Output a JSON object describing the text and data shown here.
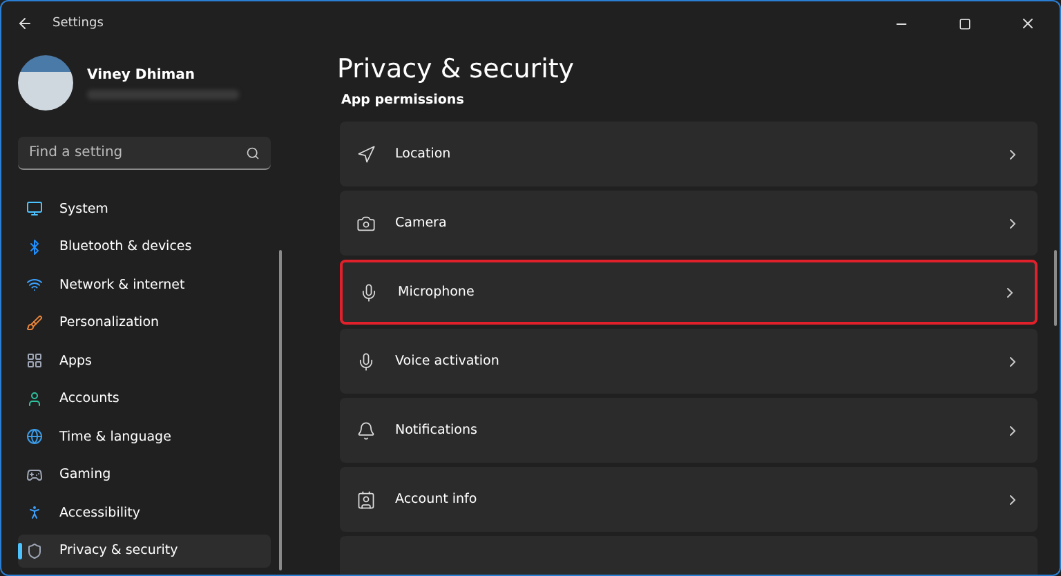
{
  "window": {
    "title": "Settings"
  },
  "user": {
    "name": "Viney Dhiman"
  },
  "search": {
    "placeholder": "Find a setting"
  },
  "sidebar": {
    "items": [
      {
        "label": "System",
        "selected": false
      },
      {
        "label": "Bluetooth & devices",
        "selected": false
      },
      {
        "label": "Network & internet",
        "selected": false
      },
      {
        "label": "Personalization",
        "selected": false
      },
      {
        "label": "Apps",
        "selected": false
      },
      {
        "label": "Accounts",
        "selected": false
      },
      {
        "label": "Time & language",
        "selected": false
      },
      {
        "label": "Gaming",
        "selected": false
      },
      {
        "label": "Accessibility",
        "selected": false
      },
      {
        "label": "Privacy & security",
        "selected": true
      }
    ]
  },
  "page": {
    "title": "Privacy & security",
    "section": "App permissions",
    "rows": [
      {
        "label": "Location",
        "highlighted": false
      },
      {
        "label": "Camera",
        "highlighted": false
      },
      {
        "label": "Microphone",
        "highlighted": true
      },
      {
        "label": "Voice activation",
        "highlighted": false
      },
      {
        "label": "Notifications",
        "highlighted": false
      },
      {
        "label": "Account info",
        "highlighted": false
      }
    ]
  }
}
